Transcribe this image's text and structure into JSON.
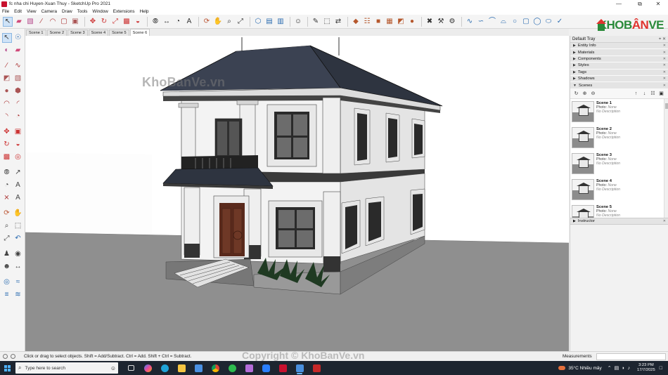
{
  "window": {
    "title": "fc nha chi Huyen-Xuan Thuy - SketchUp Pro 2021",
    "min": "—",
    "max": "⧉",
    "close": "✕"
  },
  "menu": [
    "File",
    "Edit",
    "View",
    "Camera",
    "Draw",
    "Tools",
    "Window",
    "Extensions",
    "Help"
  ],
  "logo": {
    "text_a": "KHOB",
    "text_b": "ÂN",
    "text_c": "VE"
  },
  "scene_tabs": [
    "Scene 1",
    "Scene 2",
    "Scene 3",
    "Scene 4",
    "Scene 5",
    "Scene 6"
  ],
  "active_scene_tab": "Scene 6",
  "watermark": "KhoBanVe.vn",
  "copyright": "Copyright © KhoBanVe.vn",
  "tray": {
    "title": "Default Tray",
    "panels": [
      "Entity Info",
      "Materials",
      "Components",
      "Styles",
      "Tags",
      "Shadows"
    ],
    "scenes_header": "Scenes",
    "scenes": [
      {
        "name": "Scene 1",
        "photo_label": "Photo:",
        "photo": "None",
        "desc": "No Description"
      },
      {
        "name": "Scene 2",
        "photo_label": "Photo:",
        "photo": "None",
        "desc": "No Description"
      },
      {
        "name": "Scene 3",
        "photo_label": "Photo:",
        "photo": "None",
        "desc": "No Description"
      },
      {
        "name": "Scene 4",
        "photo_label": "Photo:",
        "photo": "None",
        "desc": "No Description"
      },
      {
        "name": "Scene 5",
        "photo_label": "Photo:",
        "photo": "None",
        "desc": "No Description"
      }
    ],
    "instructor": "Instructor"
  },
  "status": {
    "message": "Click or drag to select objects. Shift = Add/Subtract. Ctrl = Add. Shift + Ctrl = Subtract.",
    "measurements_label": "Measurements"
  },
  "taskbar": {
    "search_placeholder": "Type here to search",
    "weather": "35°C  Nhiều mây",
    "time": "3:23 PM",
    "date": "17/7/2025"
  },
  "colors": {
    "roof": "#2e3440",
    "wall": "#f2f2f2",
    "trim": "#3a3a3a",
    "ground": "#8f8f8f",
    "door": "#5a2a1c",
    "taskbar": "#1d2530"
  }
}
